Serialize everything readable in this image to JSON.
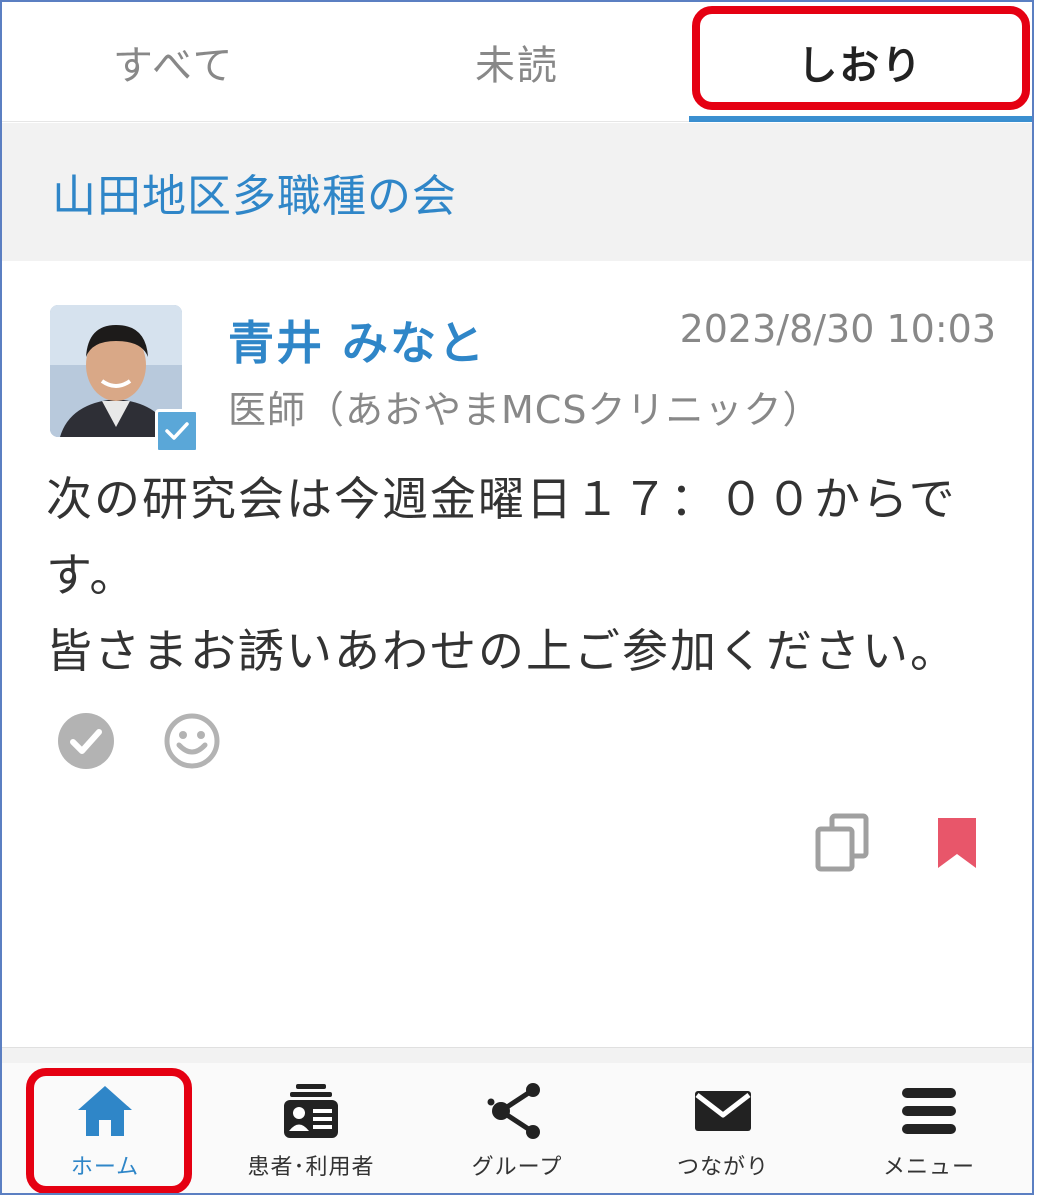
{
  "tabs": [
    {
      "label": "すべて",
      "active": false
    },
    {
      "label": "未読",
      "active": false
    },
    {
      "label": "しおり",
      "active": true
    }
  ],
  "group": {
    "title": "山田地区多職種の会"
  },
  "post": {
    "author_name": "青井 みなと",
    "author_role": "医師（あおやまMCSクリニック）",
    "timestamp": "2023/8/30 10:03",
    "message": "次の研究会は今週金曜日１７：００からです。\n皆さまお誘いあわせの上ご参加ください。",
    "reactions": [
      "check-circle-icon",
      "smiley-icon"
    ],
    "actions": [
      "copy-icon",
      "bookmark-icon"
    ]
  },
  "bottom_nav": [
    {
      "label": "ホーム",
      "icon": "home-icon",
      "active": true
    },
    {
      "label": "患者･利用者",
      "icon": "patient-card-icon",
      "active": false
    },
    {
      "label": "グループ",
      "icon": "share-icon",
      "active": false
    },
    {
      "label": "つながり",
      "icon": "mail-icon",
      "active": false
    },
    {
      "label": "メニュー",
      "icon": "menu-icon",
      "active": false
    }
  ],
  "colors": {
    "accent": "#2f86c8",
    "bookmark": "#e8566a",
    "highlight": "#e50012",
    "muted": "#888888"
  }
}
